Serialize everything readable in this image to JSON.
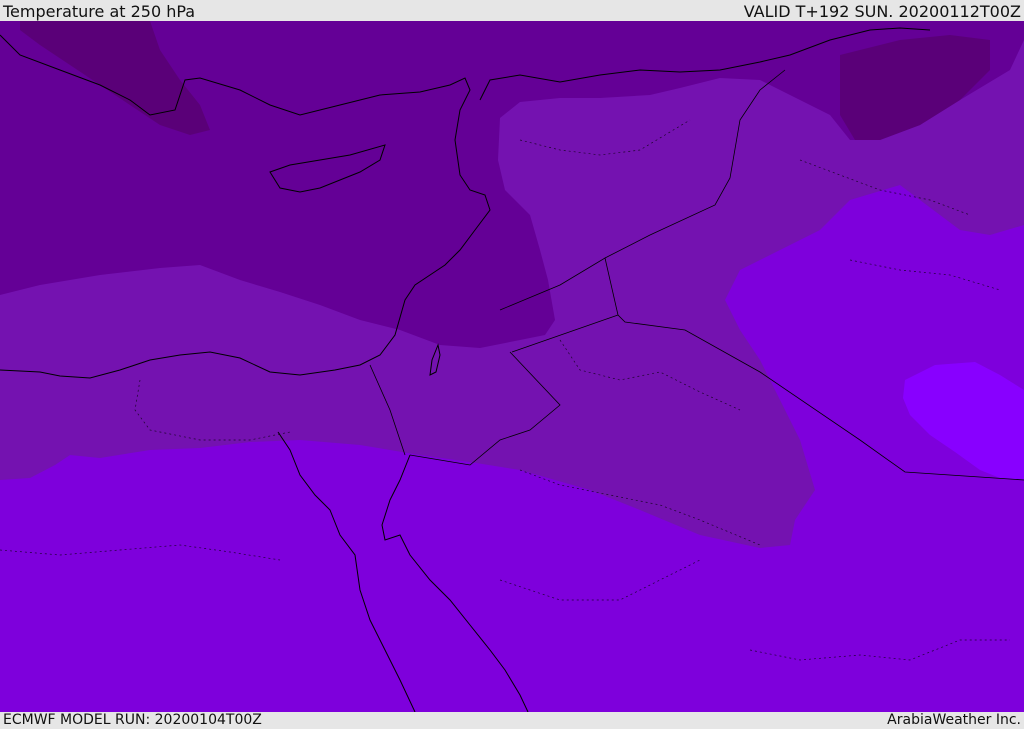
{
  "header": {
    "title": "Temperature at 250 hPa",
    "valid": "VALID T+192 SUN. 20200112T00Z"
  },
  "footer": {
    "model_run": "ECMWF MODEL RUN: 20200104T00Z",
    "brand": "ArabiaWeather Inc."
  },
  "map": {
    "field": "temperature",
    "level": "250 hPa",
    "colors": {
      "darkest_band": "#5a0078",
      "dark_band": "#640096",
      "mid_band": "#7412b0",
      "light_band": "#7e00dc",
      "lightest_band": "#8800ff",
      "coastline": "#000000"
    }
  }
}
